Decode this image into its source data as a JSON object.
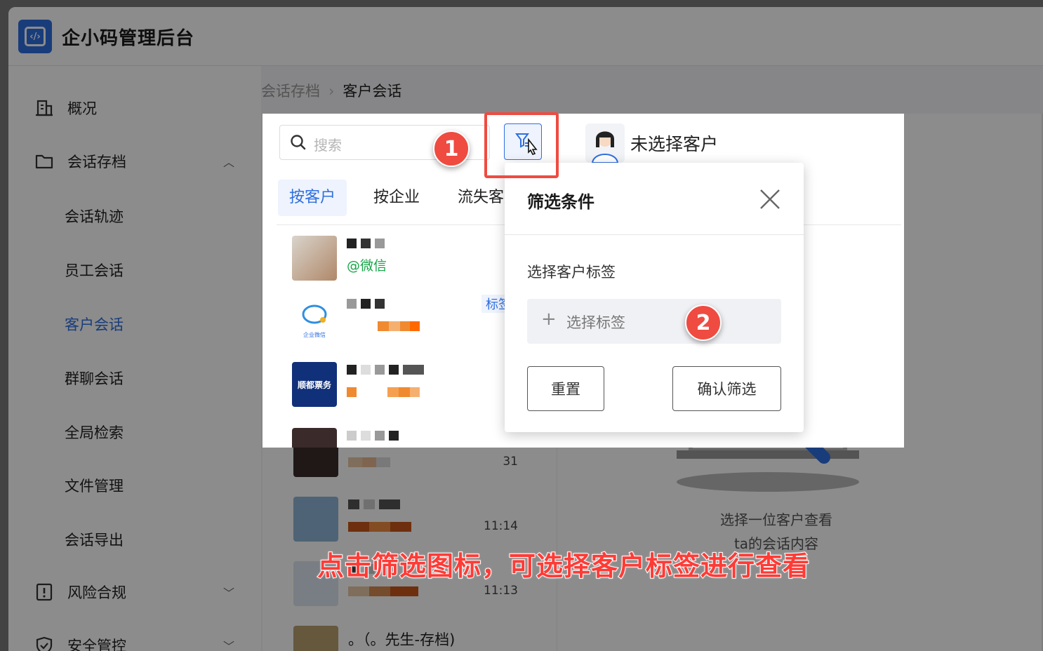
{
  "app": {
    "title": "企小码管理后台",
    "logo_glyph": "‹/›"
  },
  "sidebar": {
    "items": [
      {
        "label": "概况",
        "icon": "building-icon"
      },
      {
        "label": "会话存档",
        "icon": "folder-icon",
        "expanded": true
      },
      {
        "label": "风险合规",
        "icon": "warning-doc-icon"
      },
      {
        "label": "安全管控",
        "icon": "shield-check-icon"
      }
    ],
    "sub_items": [
      "会话轨迹",
      "员工会话",
      "客户会话",
      "群聊会话",
      "全局检索",
      "文件管理",
      "会话导出"
    ],
    "active": "客户会话"
  },
  "breadcrumb": {
    "parent": "会话存档",
    "current": "客户会话"
  },
  "search": {
    "placeholder": "搜索"
  },
  "tabs": [
    "按客户",
    "按企业",
    "流失客户"
  ],
  "list": {
    "wechat_tag": "@微信",
    "row2_badge": "标签",
    "row2_brand": "企业微信",
    "row3_brand": "顺都票务",
    "row4_time": "31",
    "row5_time": "11:14",
    "row6_time": "11:13",
    "row7_text": "。（。先生-存档)"
  },
  "header": {
    "customer": "未选择客户"
  },
  "empty_state": {
    "line1": "选择一位客户查看",
    "line2": "ta的会话内容"
  },
  "filter_popover": {
    "title": "筛选条件",
    "label": "选择客户标签",
    "select_placeholder": "选择标签",
    "reset": "重置",
    "confirm": "确认筛选"
  },
  "annotations": {
    "step1": "1",
    "step2": "2",
    "caption": "点击筛选图标，可选择客户标签进行查看"
  },
  "colors": {
    "accent": "#2f6fe0",
    "annotation_red": "#ef4b41",
    "wechat_green": "#14a546"
  }
}
